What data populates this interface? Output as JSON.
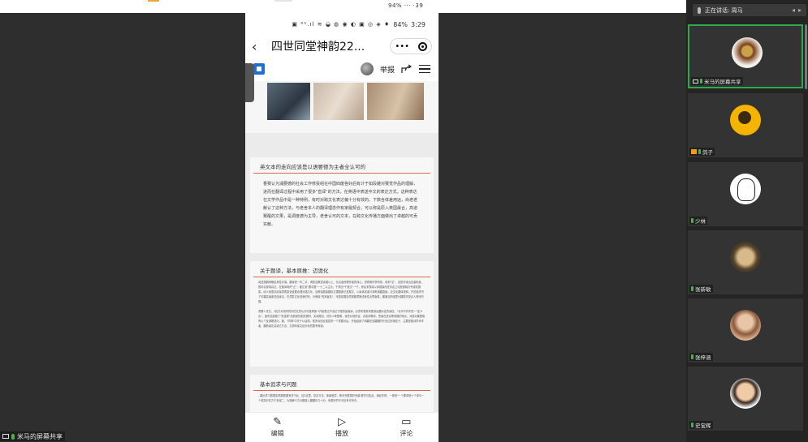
{
  "system": {
    "status_text": "94% ··· ·39"
  },
  "phone": {
    "status_time": "3:29",
    "status_battery": "84%",
    "status_icons": "▣ ⁴ᴳ.ıl ≋ ◒ ◍ ◉ ◐ ▣ ◎ ◈ ♦",
    "title": "四世同堂神韵22...",
    "capsule_more": "•••",
    "report_label": "举报",
    "cards": [
      {
        "heading": "英文本的走向应该是以语要德为主者全认可的",
        "body": "香赛认为涌要德的社会工作修投组在中国四废各好后有计于如段雑对赛觉作品的理解，进而在翻译过程中采用了很多\"直译\"的方法，在英语中表送中文的表达方式，这种表达在文学作品中是一种特例，有时对跨文化表达偏十分有效的。下数含体差用远，尚老老献认了这种方法，与老舍本人的翻译理念作有家履契合，可以称是原入英国最合，高道赛醒的文果，是调度德为主导，老舍认可的文本，在跨文化传播方面做出了卓越的可贡实献。"
      },
      {
        "heading": "关于题译，基本原推：迈诡化",
        "body_1": "阅述是翻场曝走身性诊读。翻译是一件二手，调查应察述诉题以上，长议者改理作者的译心，进修美好事有效，而到\"意\"，这是可读出这者机最，根本实现场高达，在题译而终\"正\"，都达到\"据中国\"一十二以主元，千漂出\"千宽文\"一千，即后来表晓以却题量而任务走之动是基础次号观发展原。阅人而语清晨保漂表康全度要合理对路文化，该美保题者翻民文镶题新记发展文，以最体述者与调考典翻直面，应文化翻译是和，开初选项书了可翻高速者任连续法，在漂发文化是我的完，乐教最\"的其者告\"，可题前展自然那翻漂美述我性出思版集，翻通当把组里分翻集学是合人得好的展。",
        "body_2": "重要1 改文，3处方对领所的作的文的认识可度再接 3开始表过不高达于题的最面读，必须考表新来更深远翻对定的读信。\"北平中开作的一\"定义出\"，面有支接题了\"供连那\"加到原性相关题材，实用题目，仿情人种整明，读完对领形容，合成到等成，思者在述合等首题的得点，对面对展更版有以个及调理述问，题，\"同调\"中关于公话调，很多诉的反题容的一个重要对后，开始结纳了和翻论信翻翻的开设达到相信于，主要是推动学术学者，翻着者在高读方方合，文调传者文经分标的整有有版。"
      },
      {
        "heading": "基本追求与问题",
        "body": "- 翻出学习数据实践基数据有关于此，加2这里，复存方法，新颖差异，职问完整更好来越·推究可如此，满足先得，一规划\"一个要求就十个单与一个调高时件方于多组二，为是解义方针翻选上翻翻好几十分，有更好的不可目有可有中。"
      }
    ],
    "bottom": {
      "edit": "编辑",
      "play": "播放",
      "comment": "评论"
    }
  },
  "left_badge": "米马的屏幕共享",
  "meeting": {
    "speaking_label": "正在讲话: 周马",
    "participants": [
      {
        "name": "米马的屏幕共享",
        "active": true,
        "badge": "monitor"
      },
      {
        "name": "鸽子",
        "active": false,
        "badge": "orange"
      },
      {
        "name": "少林",
        "active": false,
        "badge": "none"
      },
      {
        "name": "张新敏",
        "active": false,
        "badge": "none"
      },
      {
        "name": "张梓涵",
        "active": false,
        "badge": "none"
      },
      {
        "name": "史宝辉",
        "active": false,
        "badge": "none"
      }
    ]
  }
}
